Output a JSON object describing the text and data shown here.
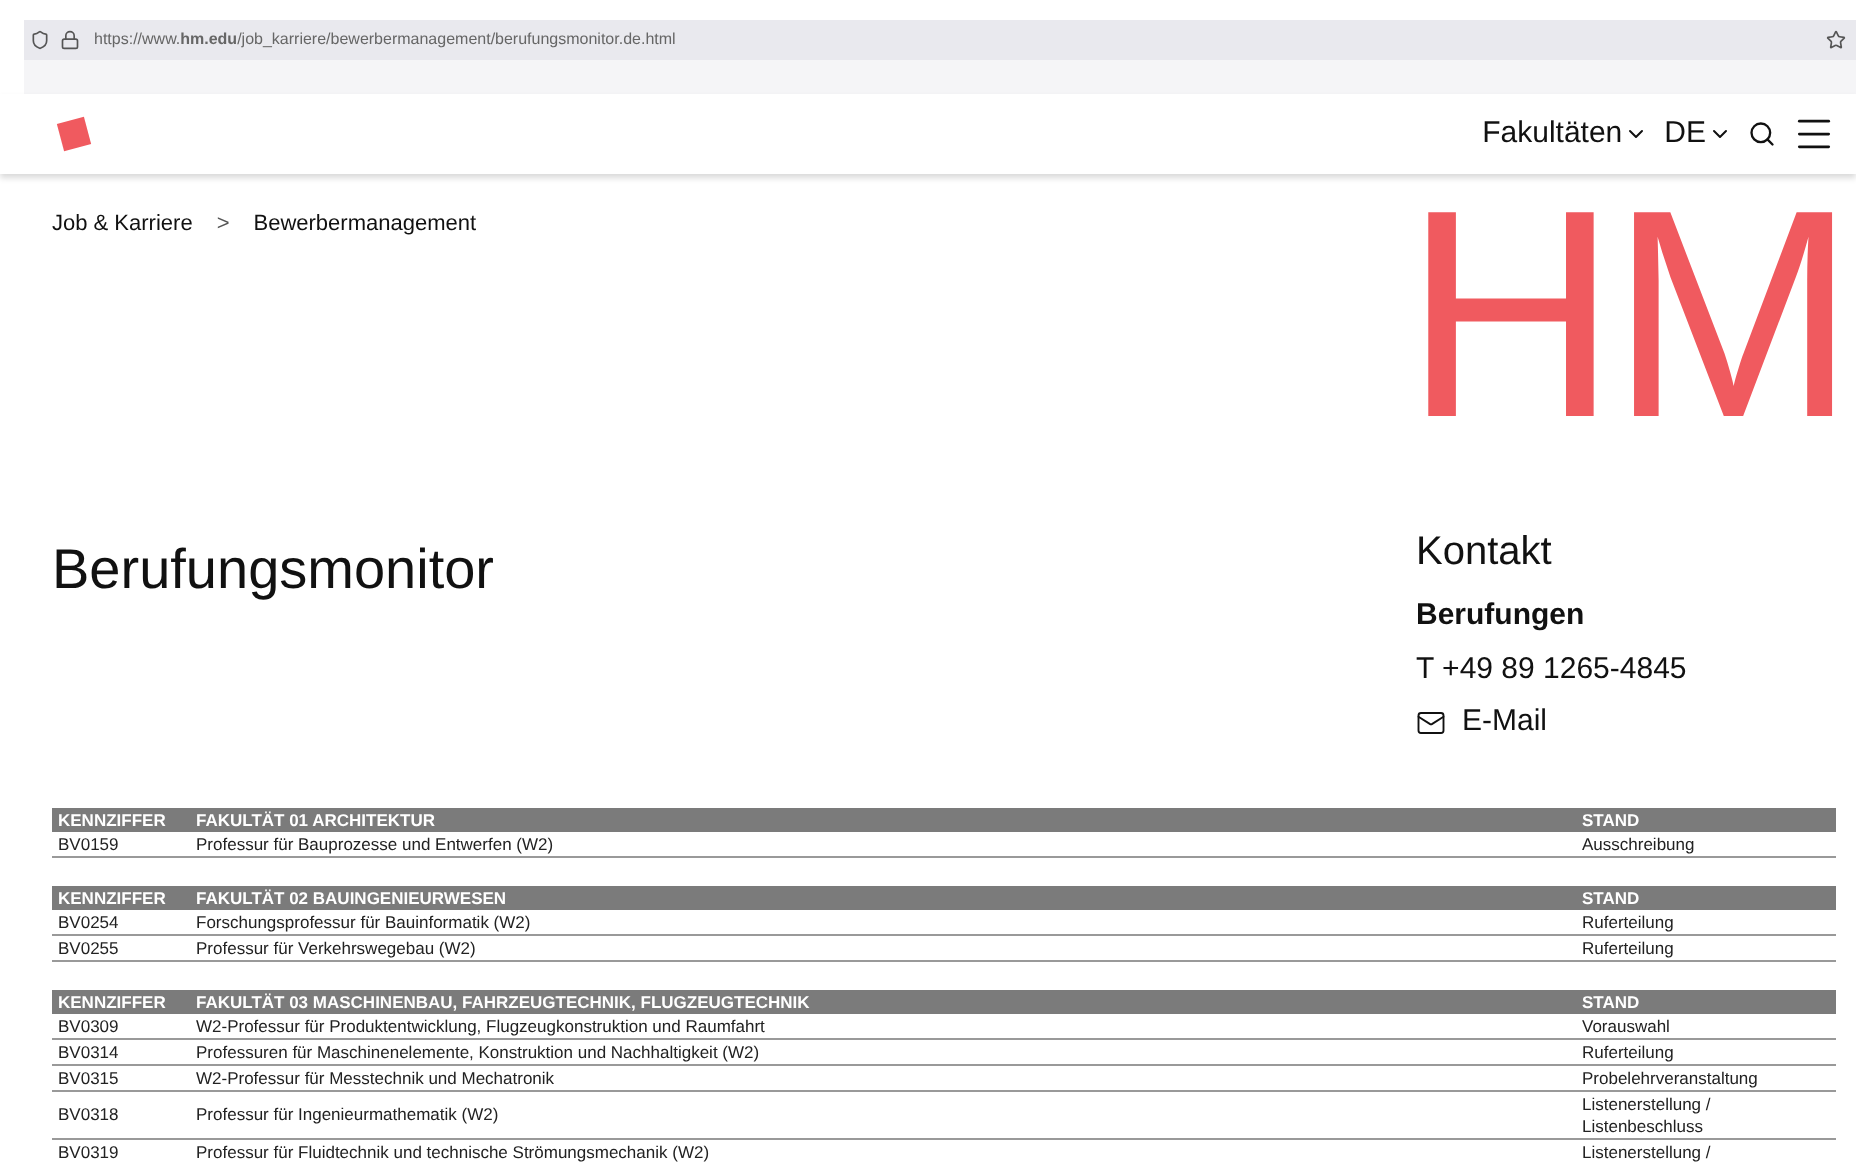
{
  "browser": {
    "url": "https://www.**hm.edu**/job_karriere/bewerbermanagement/berufungsmonitor.de.html"
  },
  "header": {
    "nav": [
      {
        "label": "Fakultäten",
        "kind": "dropdown"
      },
      {
        "label": "DE",
        "kind": "dropdown"
      }
    ]
  },
  "breadcrumb": [
    "Job & Karriere",
    "Bewerbermanagement"
  ],
  "breadcrumb_separator": ">",
  "hero_logo": "HM",
  "title": "Berufungsmonitor",
  "contact": {
    "heading": "Kontakt",
    "name": "Berufungen",
    "phone": "T +49 89 1265-4845",
    "email": "E-Mail"
  },
  "tables": [
    {
      "columns": [
        "KENNZIFFER",
        "FAKULTÄT 01 ARCHITEKTUR",
        "STAND"
      ],
      "rows": [
        {
          "id": "BV0159",
          "title": "Professur für Bauprozesse und Entwerfen (W2)",
          "status": "Ausschreibung"
        }
      ]
    },
    {
      "columns": [
        "KENNZIFFER",
        "FAKULTÄT 02 BAUINGENIEURWESEN",
        "STAND"
      ],
      "rows": [
        {
          "id": "BV0254",
          "title": "Forschungsprofessur für Bauinformatik (W2)",
          "status": "Ruferteilung"
        },
        {
          "id": "BV0255",
          "title": "Professur für Verkehrswegebau (W2)",
          "status": "Ruferteilung"
        }
      ]
    },
    {
      "columns": [
        "KENNZIFFER",
        "FAKULTÄT 03 MASCHINENBAU, FAHRZEUGTECHNIK, FLUGZEUGTECHNIK",
        "STAND"
      ],
      "rows": [
        {
          "id": "BV0309",
          "title": "W2-Professur für Produktentwicklung, Flugzeugkonstruktion und Raumfahrt",
          "status": "Vorauswahl"
        },
        {
          "id": "BV0314",
          "title": "Professuren für Maschinenelemente, Konstruktion und Nachhaltigkeit (W2)",
          "status": "Ruferteilung"
        },
        {
          "id": "BV0315",
          "title": "W2-Professur für Messtechnik und Mechatronik",
          "status": "Probelehrveranstaltung"
        },
        {
          "id": "BV0318",
          "title": "Professur für Ingenieurmathematik (W2)",
          "status": "Listenerstellung / Listenbeschluss"
        },
        {
          "id": "BV0319",
          "title": "Professur für Fluidtechnik und technische Strömungsmechanik (W2)",
          "status": "Listenerstellung /"
        }
      ]
    }
  ]
}
